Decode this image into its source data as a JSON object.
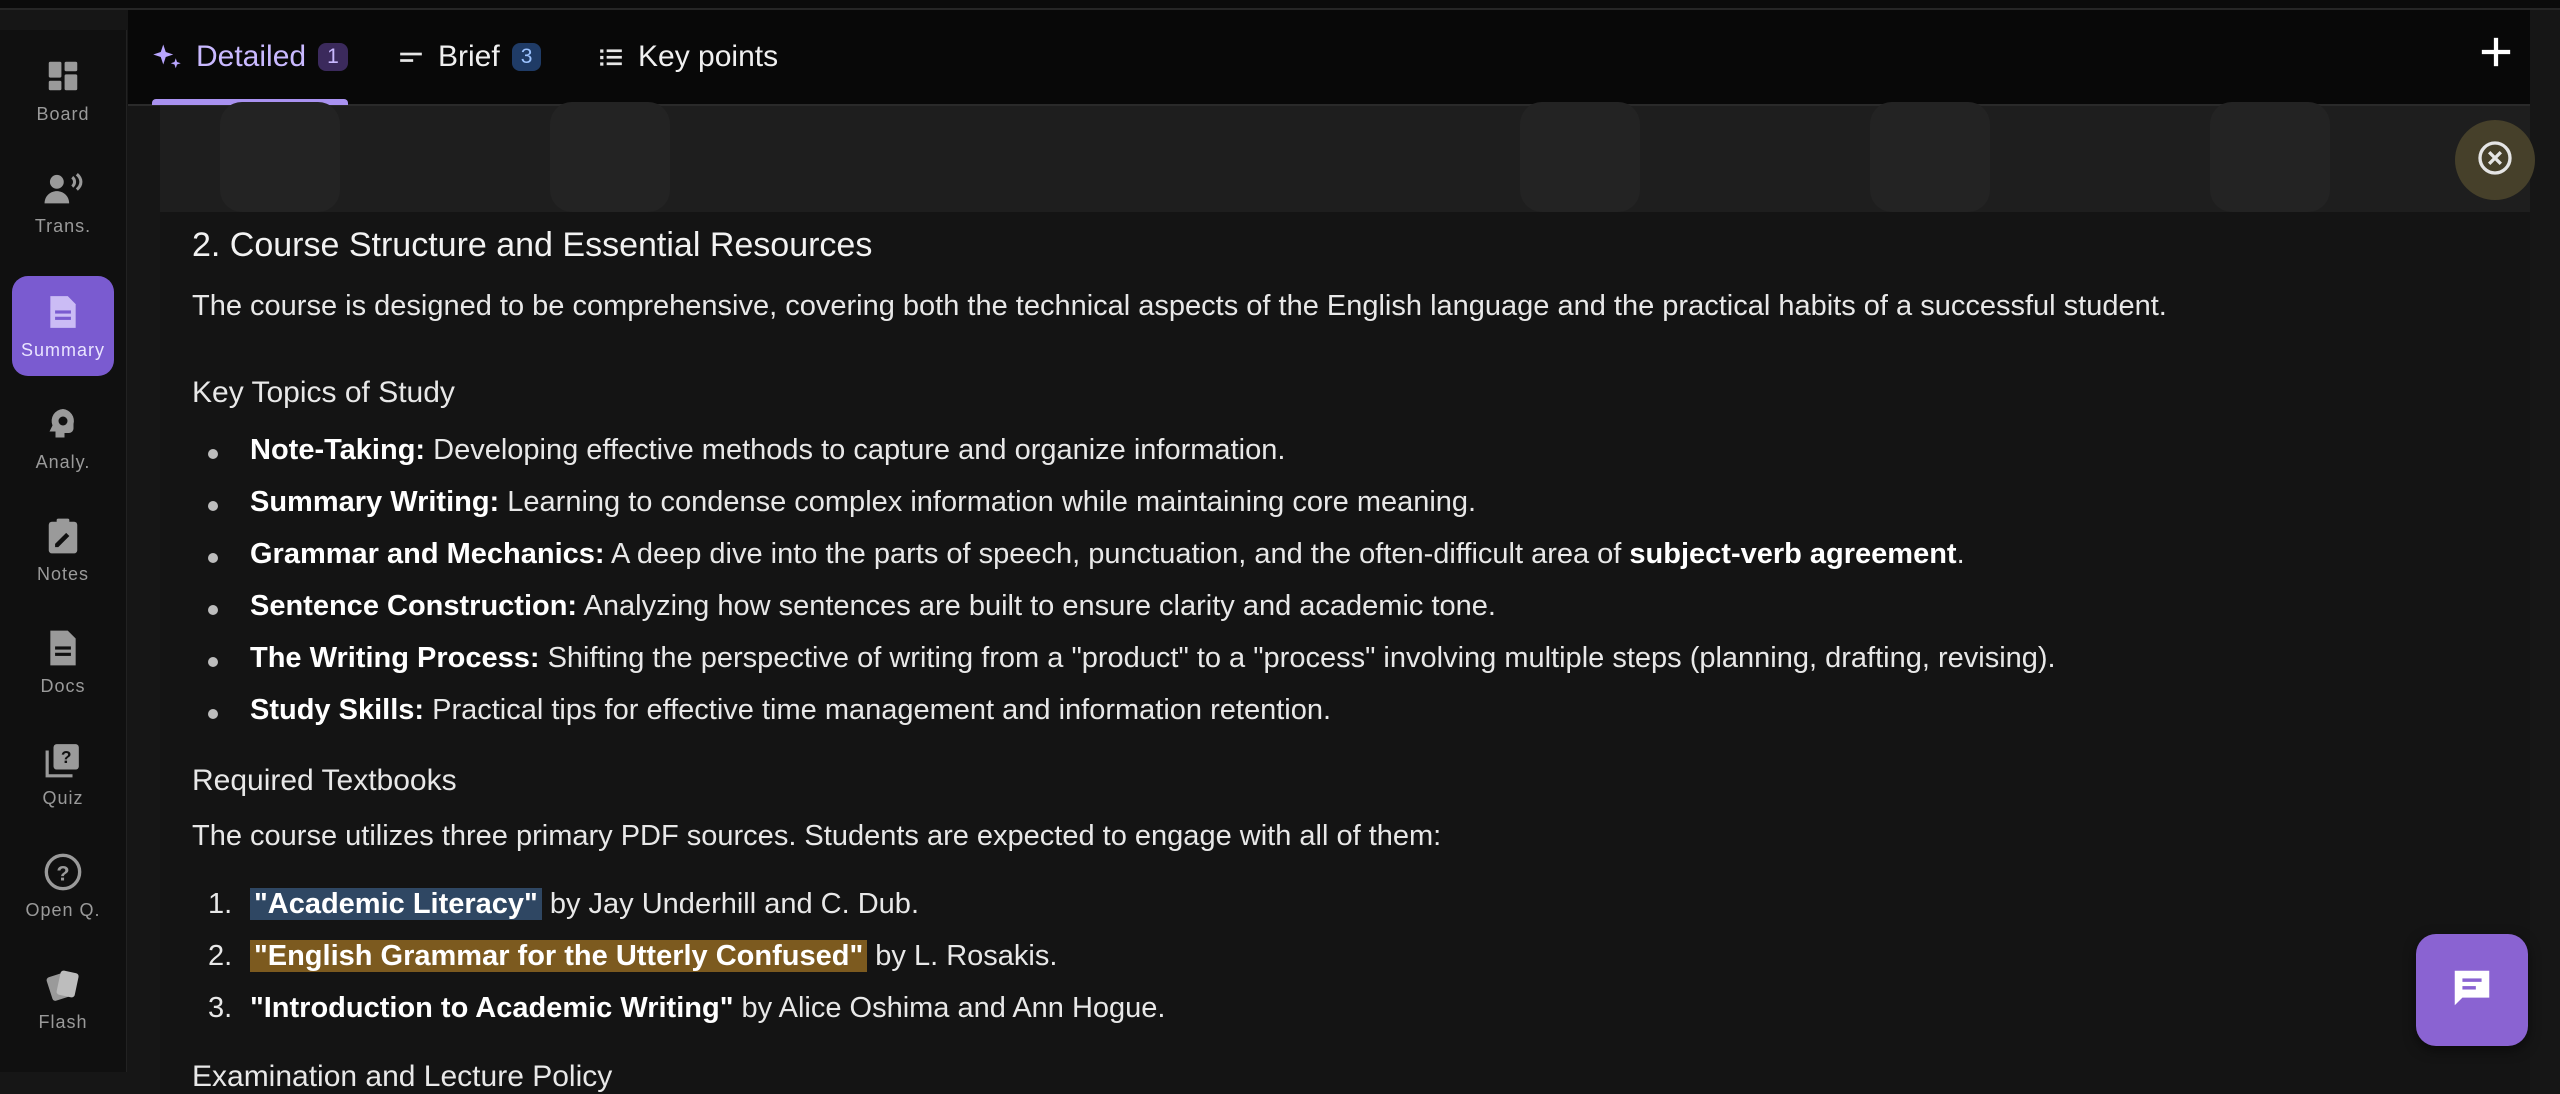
{
  "sidebar": {
    "items": [
      {
        "label": "Board",
        "icon": "board-icon"
      },
      {
        "label": "Trans.",
        "icon": "transcript-icon"
      },
      {
        "label": "Summary",
        "icon": "summary-icon",
        "active": true
      },
      {
        "label": "Analy.",
        "icon": "analysis-icon"
      },
      {
        "label": "Notes",
        "icon": "notes-icon"
      },
      {
        "label": "Docs",
        "icon": "docs-icon"
      },
      {
        "label": "Quiz",
        "icon": "quiz-icon"
      },
      {
        "label": "Open Q.",
        "icon": "question-icon"
      },
      {
        "label": "Flash",
        "icon": "flashcards-icon"
      }
    ]
  },
  "tabs": [
    {
      "label": "Detailed",
      "badge": "1",
      "icon": "sparkle-icon",
      "active": true
    },
    {
      "label": "Brief",
      "badge": "3",
      "icon": "short-lines-icon"
    },
    {
      "label": "Key points",
      "icon": "list-icon"
    }
  ],
  "section": {
    "title": "2. Course Structure and Essential Resources",
    "intro": "The course is designed to be comprehensive, covering both the technical aspects of the English language and the practical habits of a successful student.",
    "topics_heading": "Key Topics of Study",
    "topics": [
      {
        "term": "Note-Taking:",
        "text": " Developing effective methods to capture and organize information."
      },
      {
        "term": "Summary Writing:",
        "text": " Learning to condense complex information while maintaining core meaning."
      },
      {
        "term": "Grammar and Mechanics:",
        "text": " A deep dive into the parts of speech, punctuation, and the often-difficult area of ",
        "strong": "subject-verb agreement",
        "tail": "."
      },
      {
        "term": "Sentence Construction:",
        "text": " Analyzing how sentences are built to ensure clarity and academic tone."
      },
      {
        "term": "The Writing Process:",
        "text": " Shifting the perspective of writing from a \"product\" to a \"process\" involving multiple steps (planning, drafting, revising)."
      },
      {
        "term": "Study Skills:",
        "text": " Practical tips for effective time management and information retention."
      }
    ],
    "textbooks_heading": "Required Textbooks",
    "textbooks_intro": "The course utilizes three primary PDF sources. Students are expected to engage with all of them:",
    "textbooks": [
      {
        "num": "1.",
        "title": "\"Academic Literacy\"",
        "by": " by Jay Underhill and C. Dub."
      },
      {
        "num": "2.",
        "title": "\"English Grammar for the Utterly Confused\"",
        "by": " by L. Rosakis."
      },
      {
        "num": "3.",
        "title": "\"Introduction to Academic Writing\"",
        "by": " by Alice Oshima and Ann Hogue."
      }
    ],
    "next_heading": "Examination and Lecture Policy"
  },
  "colors": {
    "accent": "#7a5bd0",
    "chat": "#8a63d2",
    "highlight_blue": "#2f4763",
    "highlight_amber": "#7c5a1f"
  }
}
